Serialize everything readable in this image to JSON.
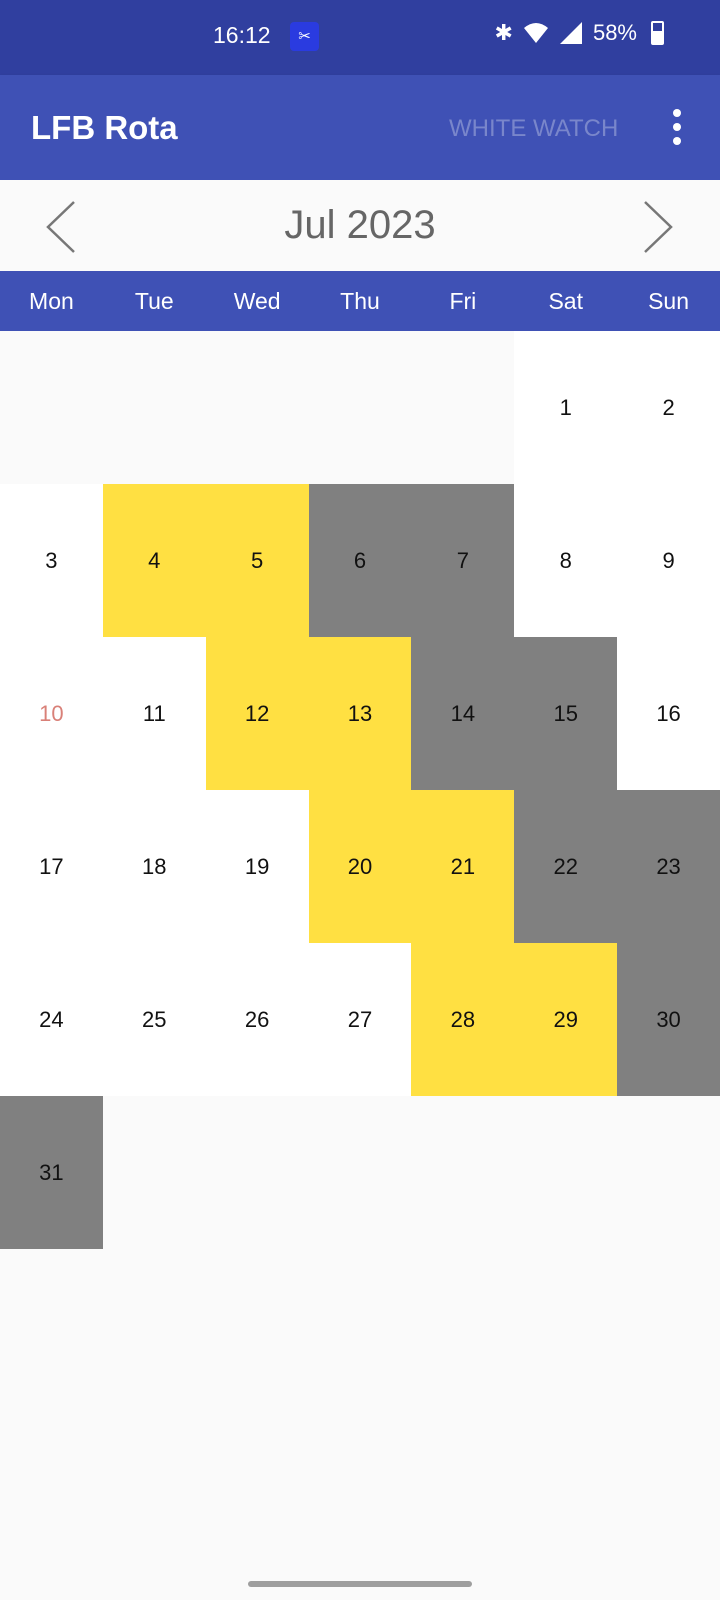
{
  "status_bar": {
    "time": "16:12",
    "battery": "58%",
    "icons": [
      "screen-record-icon",
      "bluetooth-icon",
      "wifi-icon",
      "signal-icon",
      "battery-icon"
    ]
  },
  "app_bar": {
    "title": "LFB Rota",
    "watch_label": "WHITE WATCH",
    "menu_icon": "more-vert-icon"
  },
  "calendar": {
    "month_label": "Jul 2023",
    "weekdays": [
      "Mon",
      "Tue",
      "Wed",
      "Thu",
      "Fri",
      "Sat",
      "Sun"
    ],
    "leading_blank_days": 5,
    "today": 10,
    "colors": {
      "yellow": "#FFE042",
      "gray": "#808080",
      "white": "#FFFFFF",
      "today_text": "#D98078",
      "header": "#3F51B5",
      "status_bar": "#303F9F"
    },
    "days": [
      {
        "day": "1",
        "shift": "white"
      },
      {
        "day": "2",
        "shift": "white"
      },
      {
        "day": "3",
        "shift": "white"
      },
      {
        "day": "4",
        "shift": "yellow"
      },
      {
        "day": "5",
        "shift": "yellow"
      },
      {
        "day": "6",
        "shift": "gray"
      },
      {
        "day": "7",
        "shift": "gray"
      },
      {
        "day": "8",
        "shift": "white"
      },
      {
        "day": "9",
        "shift": "white"
      },
      {
        "day": "10",
        "shift": "white"
      },
      {
        "day": "11",
        "shift": "white"
      },
      {
        "day": "12",
        "shift": "yellow"
      },
      {
        "day": "13",
        "shift": "yellow"
      },
      {
        "day": "14",
        "shift": "gray"
      },
      {
        "day": "15",
        "shift": "gray"
      },
      {
        "day": "16",
        "shift": "white"
      },
      {
        "day": "17",
        "shift": "white"
      },
      {
        "day": "18",
        "shift": "white"
      },
      {
        "day": "19",
        "shift": "white"
      },
      {
        "day": "20",
        "shift": "yellow"
      },
      {
        "day": "21",
        "shift": "yellow"
      },
      {
        "day": "22",
        "shift": "gray"
      },
      {
        "day": "23",
        "shift": "gray"
      },
      {
        "day": "24",
        "shift": "white"
      },
      {
        "day": "25",
        "shift": "white"
      },
      {
        "day": "26",
        "shift": "white"
      },
      {
        "day": "27",
        "shift": "white"
      },
      {
        "day": "28",
        "shift": "yellow"
      },
      {
        "day": "29",
        "shift": "yellow"
      },
      {
        "day": "30",
        "shift": "gray"
      },
      {
        "day": "31",
        "shift": "gray"
      }
    ]
  }
}
